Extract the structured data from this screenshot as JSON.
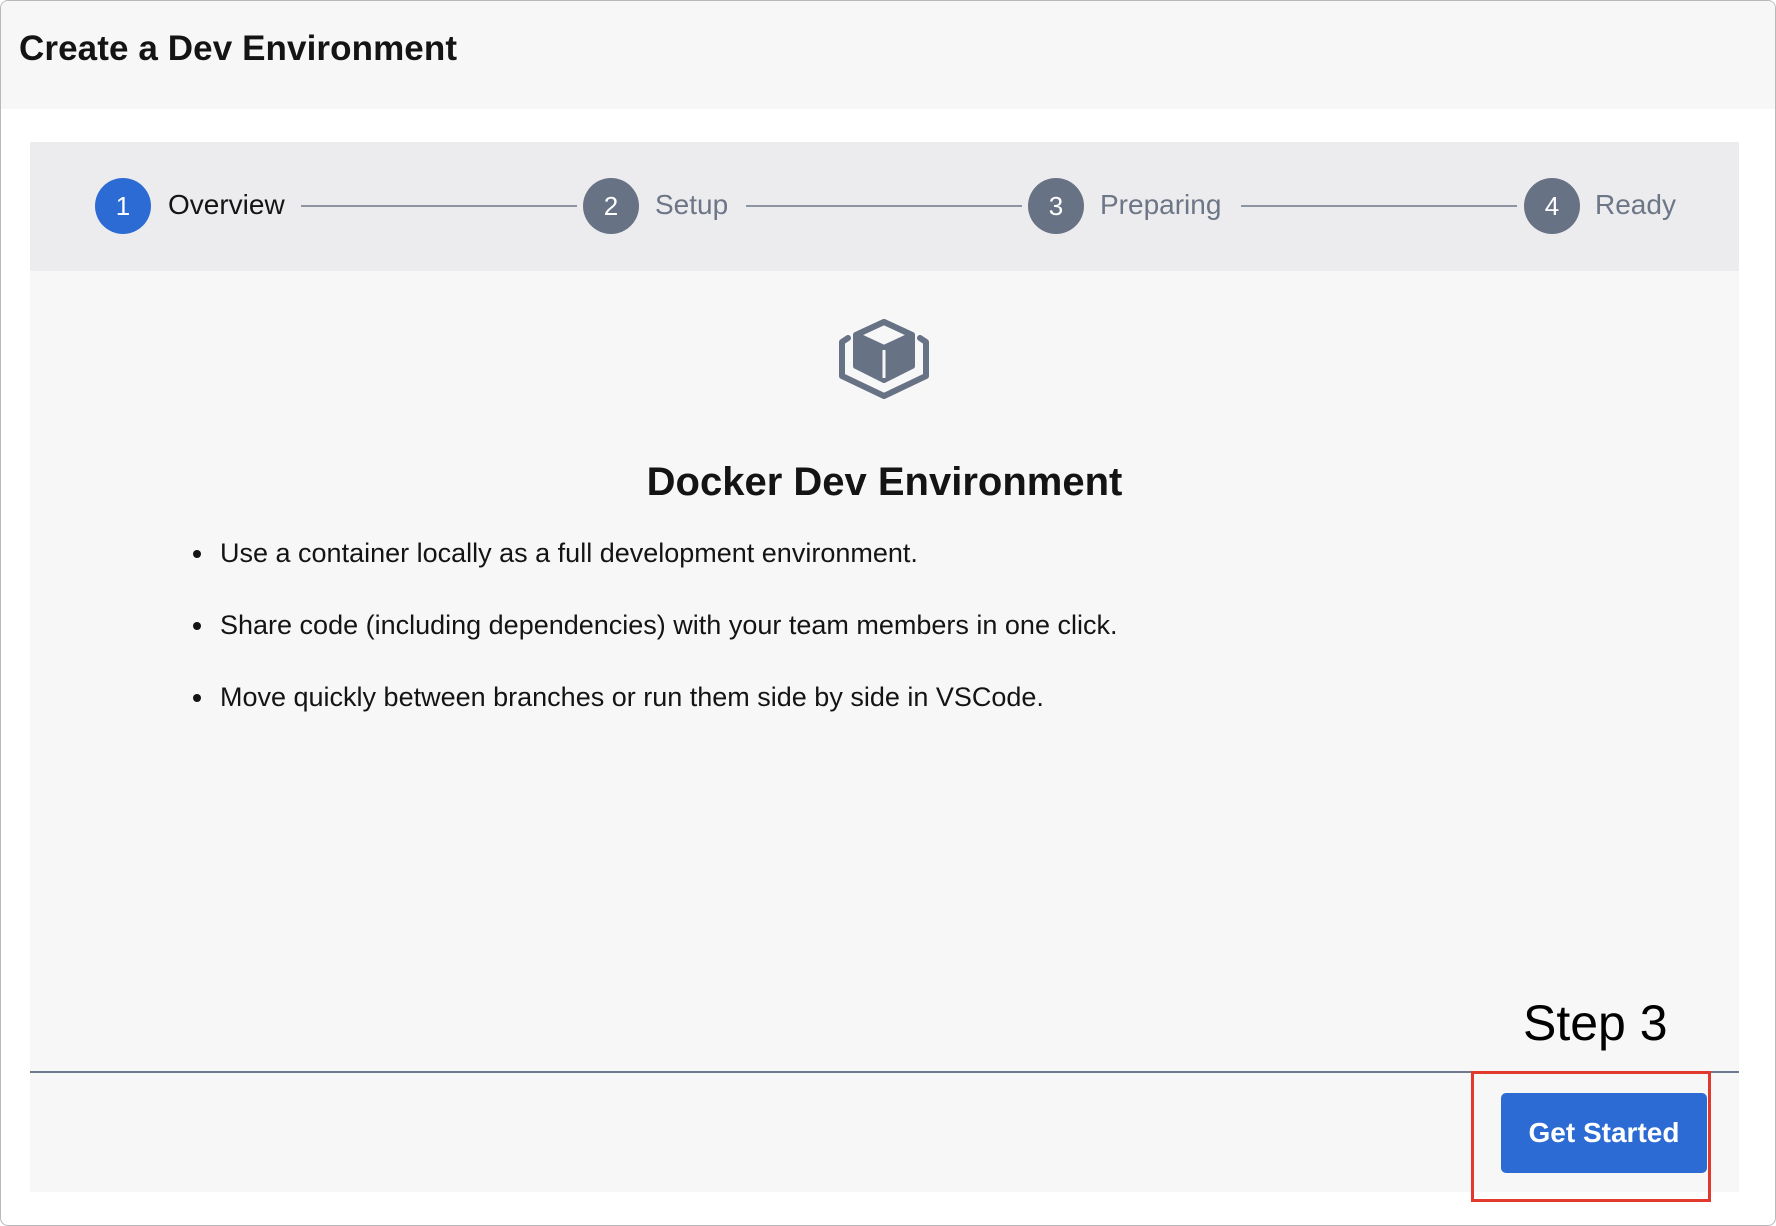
{
  "window": {
    "title": "Create a Dev Environment"
  },
  "stepper": {
    "steps": [
      {
        "number": "1",
        "label": "Overview",
        "state": "active"
      },
      {
        "number": "2",
        "label": "Setup",
        "state": "inactive"
      },
      {
        "number": "3",
        "label": "Preparing",
        "state": "inactive"
      },
      {
        "number": "4",
        "label": "Ready",
        "state": "inactive"
      }
    ]
  },
  "main": {
    "icon": "package-box-icon",
    "heading": "Docker Dev Environment",
    "bullets": [
      "Use a container locally as a full development environment.",
      "Share code (including dependencies) with your team members in one click.",
      "Move quickly between branches or run them side by side in VSCode."
    ]
  },
  "annotation": {
    "text": "Step 3",
    "highlight_color": "#e1392b"
  },
  "footer": {
    "primary_button_label": "Get Started"
  },
  "colors": {
    "accent": "#2c6bd3",
    "step_inactive": "#677285"
  }
}
